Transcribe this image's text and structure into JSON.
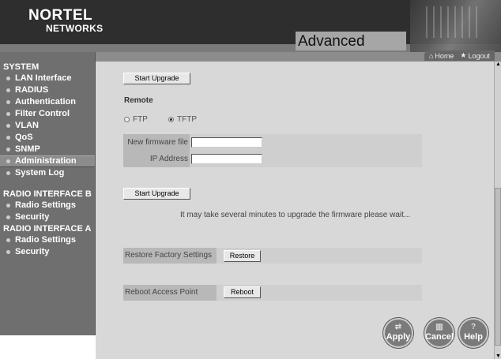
{
  "brand": {
    "line1": "NORTEL",
    "line2": "NETWORKS"
  },
  "page_title": "Advanced Setup",
  "topnav": {
    "home": "Home",
    "logout": "Logout"
  },
  "sidebar": {
    "group_system": "SYSTEM",
    "system_items": [
      {
        "label": "LAN Interface"
      },
      {
        "label": "RADIUS"
      },
      {
        "label": "Authentication"
      },
      {
        "label": "Filter Control"
      },
      {
        "label": "VLAN"
      },
      {
        "label": "QoS"
      },
      {
        "label": "SNMP"
      },
      {
        "label": "Administration"
      },
      {
        "label": "System Log"
      }
    ],
    "group_radio_b": "RADIO INTERFACE B",
    "radio_b_items": [
      {
        "label": "Radio Settings"
      },
      {
        "label": "Security"
      }
    ],
    "group_radio_a": "RADIO INTERFACE A",
    "radio_a_items": [
      {
        "label": "Radio Settings"
      },
      {
        "label": "Security"
      }
    ]
  },
  "main": {
    "start_upgrade_1": "Start Upgrade",
    "remote_label": "Remote",
    "ftp_label": "FTP",
    "tftp_label": "TFTP",
    "new_firmware_label": "New firmware file",
    "new_firmware_value": "",
    "ip_address_label": "IP Address",
    "ip_address_value": "",
    "start_upgrade_2": "Start Upgrade",
    "wait_note": "It may take several minutes to upgrade the firmware please wait...",
    "restore_label": "Restore Factory Settings",
    "restore_button": "Restore",
    "reboot_label": "Reboot Access Point",
    "reboot_button": "Reboot"
  },
  "actions": {
    "apply": "Apply",
    "cancel": "Cancel",
    "help": "Help"
  }
}
